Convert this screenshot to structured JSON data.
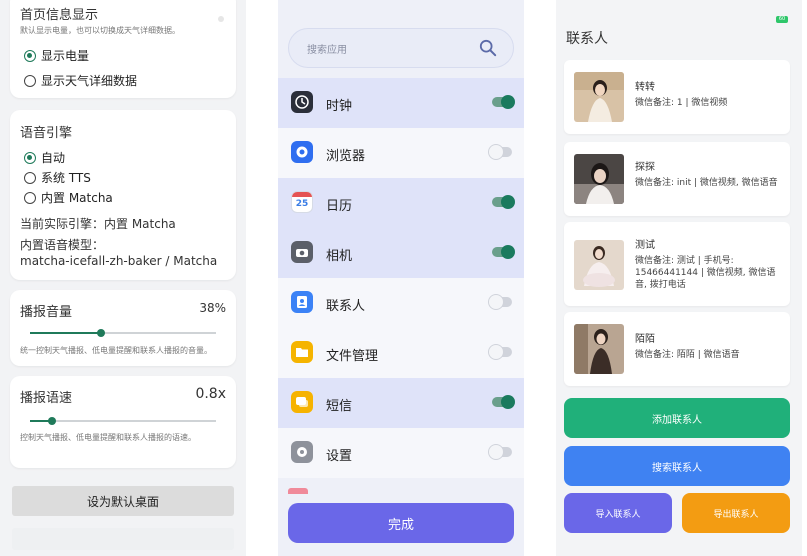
{
  "panel1": {
    "card1": {
      "title": "首页信息显示",
      "desc": "默认显示电量，也可以切换成天气详细数据。",
      "options": [
        "显示电量",
        "显示天气详细数据"
      ],
      "selected": 0
    },
    "voice": {
      "title": "语音引擎",
      "options": [
        "自动",
        "系统 TTS",
        "内置 Matcha"
      ],
      "selected": 0,
      "current": "当前实际引擎：内置 Matcha",
      "model_label": "内置语音模型：",
      "model_value": "matcha-icefall-zh-baker / Matcha"
    },
    "volume": {
      "title": "播报音量",
      "value": "38%",
      "level": 0.38,
      "desc": "统一控制天气播报、低电量提醒和联系人播报的音量。"
    },
    "speed": {
      "title": "播报语速",
      "value": "0.8x",
      "level": 0.12,
      "desc": "控制天气播报、低电量提醒和联系人播报的语速。"
    },
    "default_button": "设为默认桌面"
  },
  "panel2": {
    "search_placeholder": "搜索应用",
    "apps": [
      {
        "name": "时钟",
        "enabled": true,
        "icon": "clock-icon",
        "color": "#2b2f3a"
      },
      {
        "name": "浏览器",
        "enabled": false,
        "icon": "browser-icon",
        "color": "#2f6ef0"
      },
      {
        "name": "日历",
        "enabled": true,
        "icon": "calendar-icon",
        "color": "#3a7de6",
        "badge": "25"
      },
      {
        "name": "相机",
        "enabled": true,
        "icon": "camera-icon",
        "color": "#5b5f69"
      },
      {
        "name": "联系人",
        "enabled": false,
        "icon": "contacts-icon",
        "color": "#3b82f6"
      },
      {
        "name": "文件管理",
        "enabled": false,
        "icon": "folder-icon",
        "color": "#f5b400"
      },
      {
        "name": "短信",
        "enabled": true,
        "icon": "message-icon",
        "color": "#f6b301"
      },
      {
        "name": "设置",
        "enabled": false,
        "icon": "settings-icon",
        "color": "#8e929b"
      }
    ],
    "done_button": "完成"
  },
  "panel3": {
    "title": "联系人",
    "battery": "60",
    "contacts": [
      {
        "name": "转转",
        "note": "微信备注: 1 | 微信视频"
      },
      {
        "name": "探探",
        "note": "微信备注: init | 微信视频, 微信语音"
      },
      {
        "name": "测试",
        "note": "微信备注: 测试 | 手机号: 15466441144 | 微信视频, 微信语音, 拨打电话"
      },
      {
        "name": "陌陌",
        "note": "微信备注: 陌陌 | 微信语音"
      }
    ],
    "add_button": "添加联系人",
    "search_button": "搜索联系人",
    "import_button": "导入联系人",
    "export_button": "导出联系人"
  },
  "colors": {
    "green": "#1f7a5a",
    "add_button": "#20b07a",
    "search_button": "#3f82f2",
    "import_button": "#6a67e8",
    "export_button": "#f39c12",
    "done_button": "#6a67e8"
  }
}
